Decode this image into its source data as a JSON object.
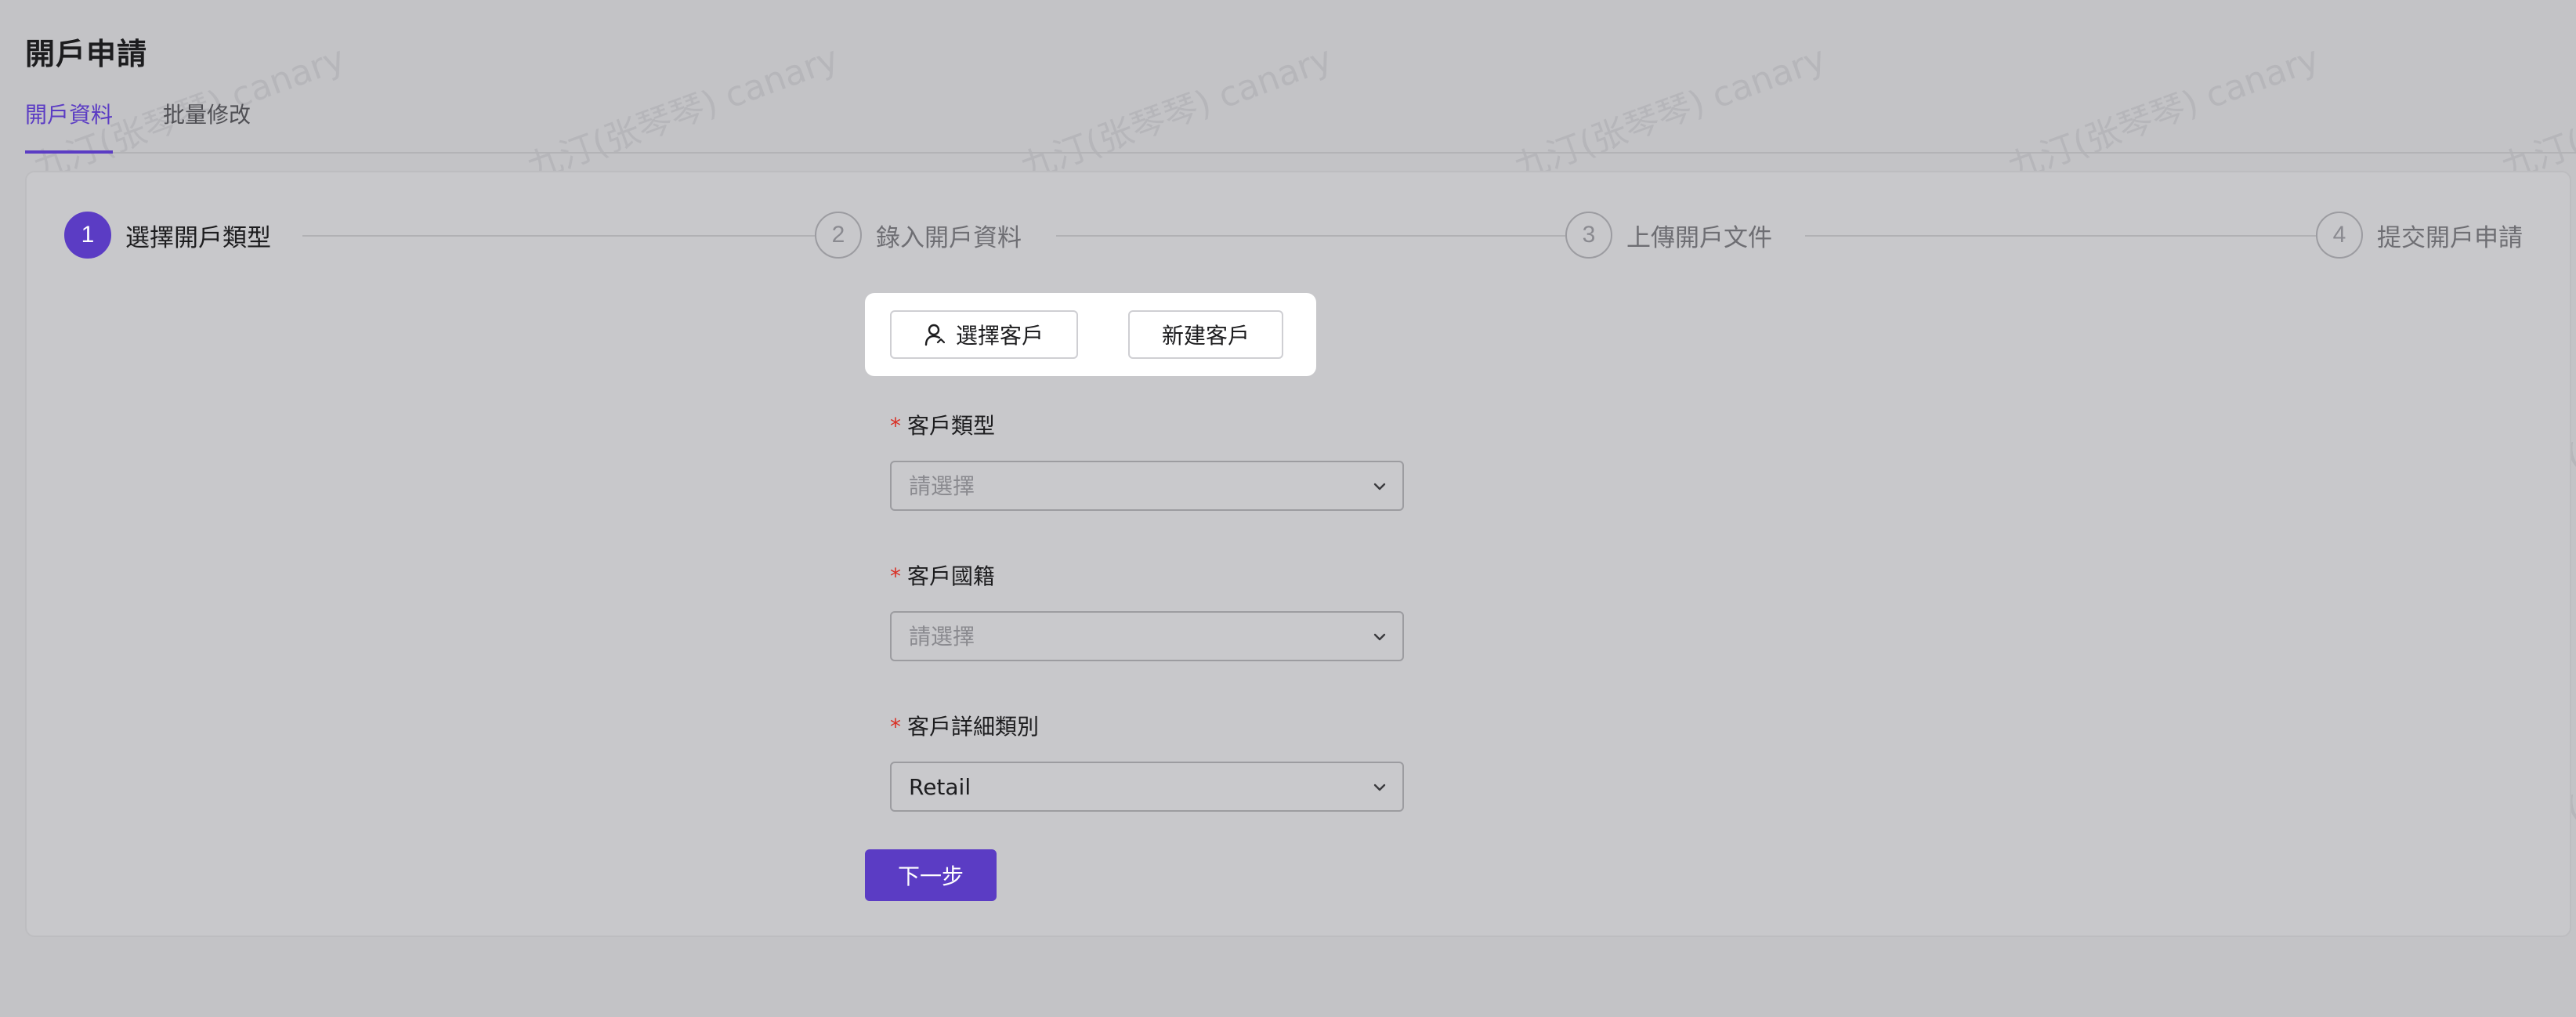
{
  "page": {
    "title": "開戶申請",
    "watermark": "九汀(张琴琴) canary"
  },
  "tabs": [
    {
      "label": "開戶資料",
      "active": true
    },
    {
      "label": "批量修改",
      "active": false
    }
  ],
  "steps": [
    {
      "number": "1",
      "label": "選擇開戶類型",
      "active": true
    },
    {
      "number": "2",
      "label": "錄入開戶資料",
      "active": false
    },
    {
      "number": "3",
      "label": "上傳開戶文件",
      "active": false
    },
    {
      "number": "4",
      "label": "提交開戶申請",
      "active": false
    }
  ],
  "customer_actions": {
    "select_label": "選擇客戶",
    "select_icon": "user-icon",
    "new_label": "新建客戶"
  },
  "form": {
    "fields": [
      {
        "label": "客戶類型",
        "required": true,
        "value": "",
        "placeholder": "請選擇"
      },
      {
        "label": "客戶國籍",
        "required": true,
        "value": "",
        "placeholder": "請選擇"
      },
      {
        "label": "客戶詳細類別",
        "required": true,
        "value": "Retail",
        "placeholder": "請選擇"
      }
    ],
    "required_mark": "*",
    "next_label": "下一步"
  },
  "colors": {
    "accent": "#5b3cc4",
    "required": "#d93025",
    "overlay_background": "#c3c3c6"
  }
}
